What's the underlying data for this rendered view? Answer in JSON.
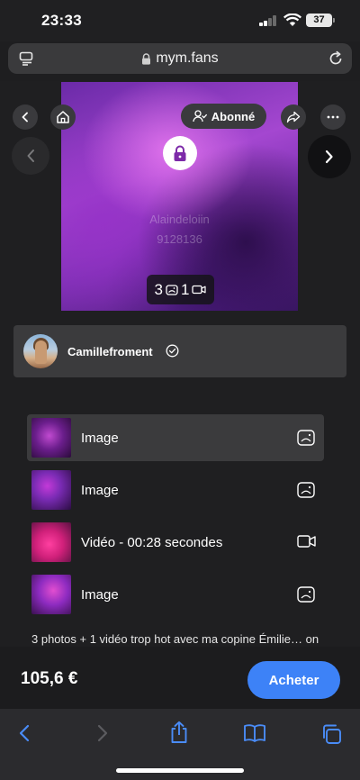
{
  "status_bar": {
    "time": "23:33",
    "battery": "37"
  },
  "browser": {
    "url": "mym.fans"
  },
  "media": {
    "watermark_line1": "Alaindeloiin",
    "watermark_line2": "9128136",
    "photo_count": "3",
    "video_count": "1"
  },
  "overlay": {
    "subscribed_label": "Abonné"
  },
  "creator": {
    "name": "Camillefroment"
  },
  "content_list": [
    {
      "label": "Image",
      "type": "image"
    },
    {
      "label": "Image",
      "type": "image"
    },
    {
      "label": "Vidéo - 00:28 secondes",
      "type": "video"
    },
    {
      "label": "Image",
      "type": "image"
    }
  ],
  "description": "3 photos + 1 vidéo trop hot avec ma copine Émilie… on",
  "purchase": {
    "price": "105,6 €",
    "buy_label": "Acheter"
  },
  "colors": {
    "accent": "#3d82f7",
    "background": "#1f1f21",
    "card": "#3b3b3d"
  }
}
